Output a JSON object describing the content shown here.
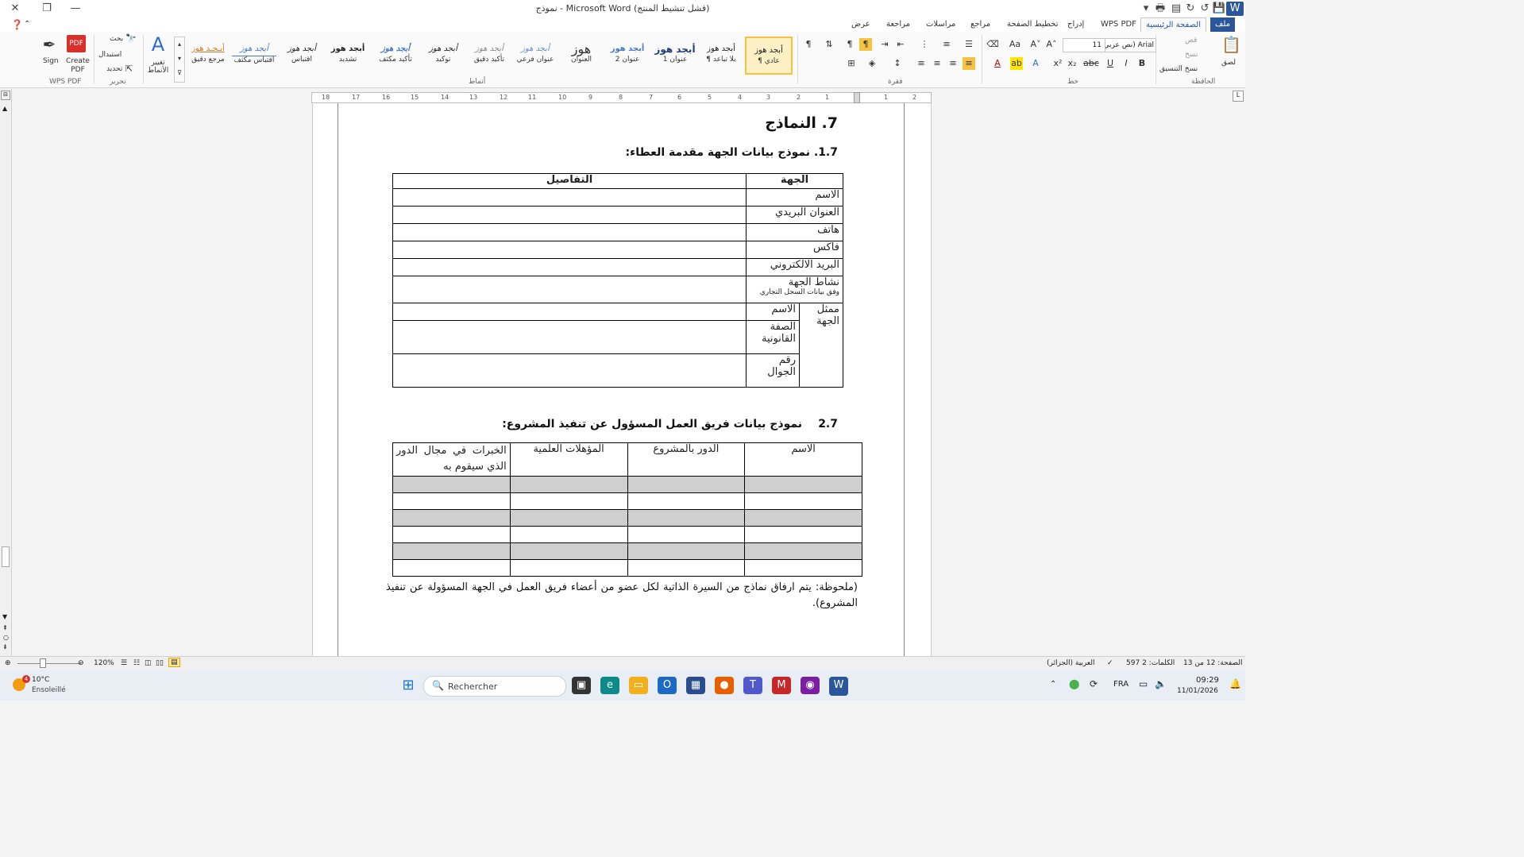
{
  "window": {
    "title": "نموذج - Microsoft Word (فشل تنشيط المنتج)"
  },
  "tabs": [
    "ملف",
    "الصفحة الرئيسية",
    "WPS PDF",
    "إدراج",
    "تخطيط الصفحة",
    "مراجع",
    "مراسلات",
    "مراجعة",
    "عرض"
  ],
  "clipboard": {
    "paste": "لصق",
    "cut": "قص",
    "copy": "نسخ",
    "format_painter": "نسخ التنسيق",
    "label": "الحافظة"
  },
  "font": {
    "name": "Arial (نص عربي) أساسي",
    "size": "11",
    "label": "خط"
  },
  "paragraph": {
    "label": "فقرة"
  },
  "styles": {
    "label": "أنماط",
    "items": [
      {
        "sample": "أبجد هوز",
        "name": "¶ عادي"
      },
      {
        "sample": "أبجد هوز",
        "name": "¶ بلا تباعد"
      },
      {
        "sample": "أبجد هوز",
        "name": "عنوان 1"
      },
      {
        "sample": "أبجد هوز",
        "name": "عنوان 2"
      },
      {
        "sample": "هوز",
        "name": "العنوان"
      },
      {
        "sample": "أبجد هوز",
        "name": "عنوان فرعي"
      },
      {
        "sample": "أبجد هوز",
        "name": "تأكيد دقيق"
      },
      {
        "sample": "أبجد هوز",
        "name": "توكيد"
      },
      {
        "sample": "أبجد هوز",
        "name": "تأكيد مكثف"
      },
      {
        "sample": "أبجد هوز",
        "name": "تشديد"
      },
      {
        "sample": "أبجد هوز",
        "name": "اقتباس"
      },
      {
        "sample": "أبجد هوز",
        "name": "اقتباس مكثف"
      },
      {
        "sample": "أبـجـد هوز",
        "name": "مرجع دقيق"
      }
    ],
    "change": "تغيير الأنماط"
  },
  "editing": {
    "find": "بحث",
    "replace": "استبدال",
    "select": "تحديد",
    "label": "تحرير"
  },
  "wps": {
    "create_pdf": "Create PDF",
    "sign": "Sign",
    "label": "WPS PDF"
  },
  "ruler": [
    "18",
    "17",
    "16",
    "15",
    "14",
    "13",
    "12",
    "11",
    "10",
    "9",
    "8",
    "7",
    "6",
    "5",
    "4",
    "3",
    "2",
    "1",
    "1",
    "2"
  ],
  "document": {
    "h7": "7. النماذج",
    "h71": "1.7. نموذج بيانات الجهة مقدمة العطاء:",
    "t1_headers": {
      "entity": "الجهة",
      "details": "التفاصيل"
    },
    "t1_rows": [
      "الاسم",
      "العنوان البريدي",
      "هاتف",
      "فاكس",
      "البريد الالكتروني",
      "نشاط الجهة"
    ],
    "t1_activity_note": "وفق بيانات السجل التجاري",
    "t1_rep": "ممثل الجهة",
    "t1_rep_rows": [
      "الاسم",
      "الصفة القانونية",
      "رقم الجوال"
    ],
    "h72_num": "2.7",
    "h72_text": "نموذج بيانات فريق العمل المسؤول عن تنفيذ المشروع:",
    "t2_headers": [
      "الاسم",
      "الدور بالمشروع",
      "المؤهلات العلمية",
      "الخبرات في مجال الدور الذي سيقوم به"
    ],
    "note": "(ملحوظة: يتم ارفاق نماذج من السيرة الذاتية لكل عضو من أعضاء فريق العمل في الجهة المسؤولة عن تنفيذ المشروع)."
  },
  "status": {
    "page": "الصفحة: 12 من 13",
    "words": "الكلمات: 2 597",
    "lang": "العربية (الجزائر)",
    "zoom": "120%"
  },
  "taskbar": {
    "weather_temp": "10°C",
    "weather_desc": "Ensoleillé",
    "search": "Rechercher",
    "lang": "FRA",
    "time": "09:29",
    "date": "11/01/2026",
    "badge": "4"
  }
}
